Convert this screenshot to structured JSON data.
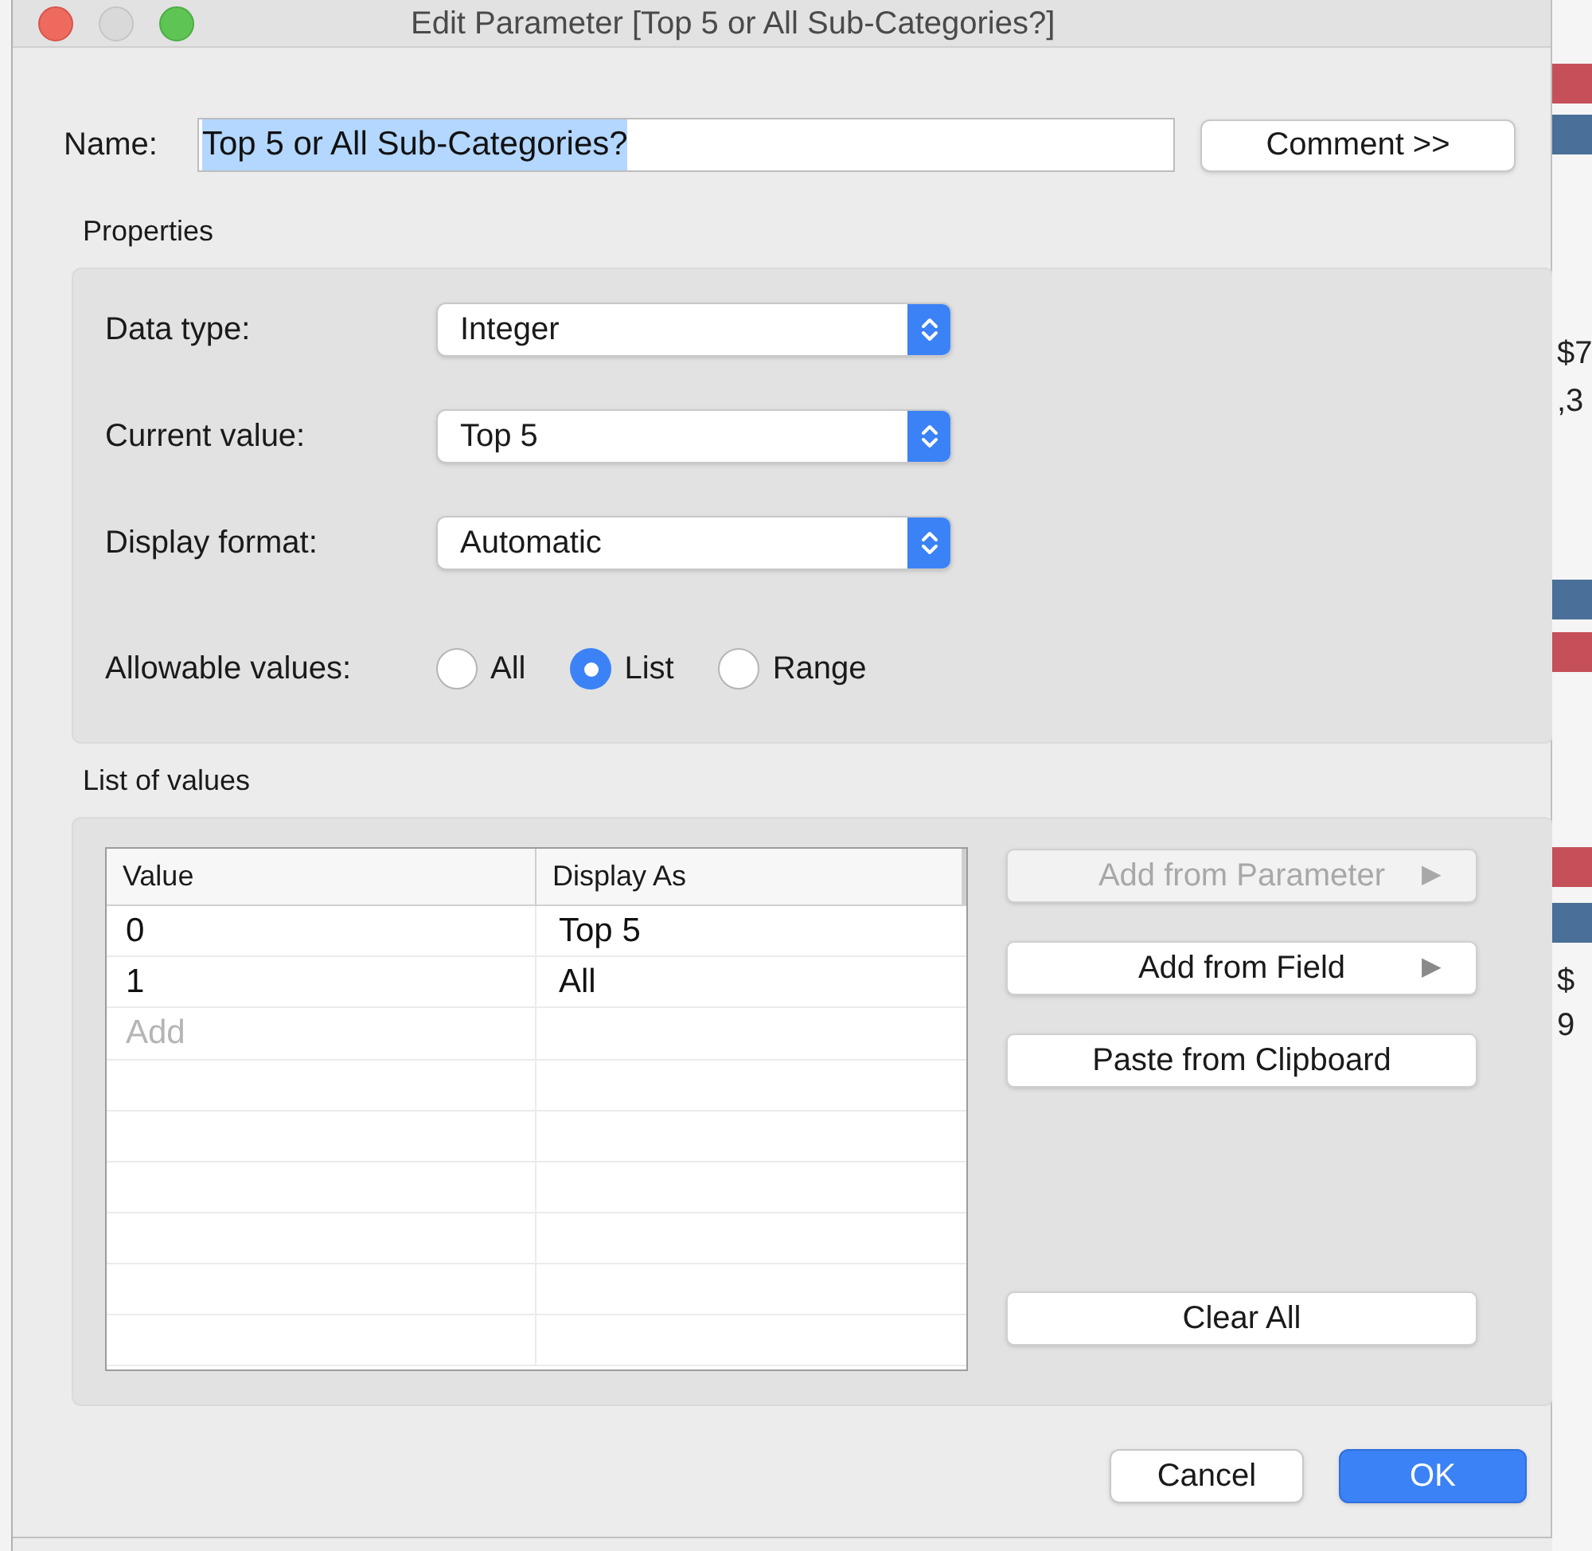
{
  "background": {
    "right_items": [
      {
        "kind": "bar",
        "color": "#c5505a"
      },
      {
        "kind": "bar",
        "color": "#4a6f98"
      },
      {
        "kind": "text",
        "text": "$7"
      },
      {
        "kind": "text",
        "text": ",3"
      },
      {
        "kind": "bar",
        "color": "#4a6f98"
      },
      {
        "kind": "bar",
        "color": "#c5505a"
      },
      {
        "kind": "bar",
        "color": "#c5505a"
      },
      {
        "kind": "bar",
        "color": "#4a6f98"
      },
      {
        "kind": "text",
        "text": "$"
      },
      {
        "kind": "text",
        "text": "9"
      }
    ]
  },
  "window": {
    "title": "Edit Parameter [Top 5 or All Sub-Categories?]"
  },
  "name": {
    "label": "Name:",
    "value": "Top 5 or All Sub-Categories?",
    "text_selected": true
  },
  "comment_button": "Comment >>",
  "properties": {
    "title": "Properties",
    "rows": [
      {
        "kind": "dropdown",
        "label": "Data type:",
        "value": "Integer"
      },
      {
        "kind": "dropdown",
        "label": "Current value:",
        "value": "Top 5"
      },
      {
        "kind": "dropdown",
        "label": "Display format:",
        "value": "Automatic"
      },
      {
        "kind": "radios",
        "label": "Allowable values:",
        "options": [
          {
            "label": "All",
            "selected": false
          },
          {
            "label": "List",
            "selected": true
          },
          {
            "label": "Range",
            "selected": false
          }
        ]
      }
    ]
  },
  "list_of_values": {
    "title": "List of values",
    "table": {
      "columns": [
        "Value",
        "Display As"
      ],
      "rows": [
        {
          "value": "0",
          "display": "Top 5"
        },
        {
          "value": "1",
          "display": "All"
        }
      ],
      "add_placeholder": "Add"
    },
    "buttons": [
      {
        "label": "Add from Parameter",
        "arrow": "▶",
        "disabled": true
      },
      {
        "label": "Add from Field",
        "arrow": "▶",
        "disabled": false
      },
      {
        "label": "Paste from Clipboard",
        "disabled": false
      },
      {
        "label": "Clear All",
        "disabled": false
      }
    ]
  },
  "footer_buttons": [
    {
      "label": "Cancel",
      "default": false
    },
    {
      "label": "OK",
      "default": true
    }
  ]
}
